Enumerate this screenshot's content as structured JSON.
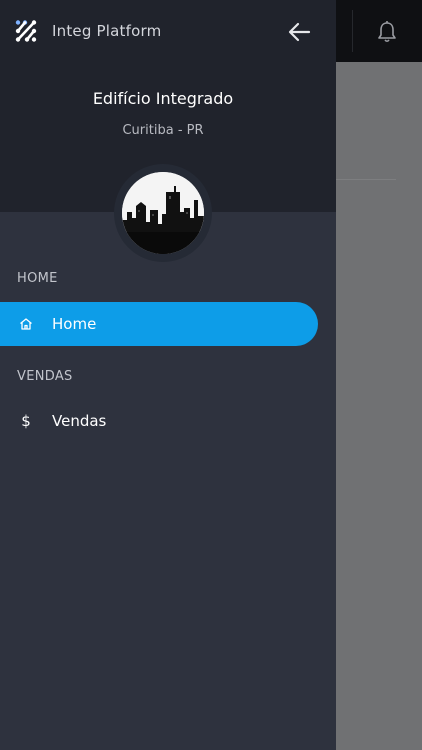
{
  "app": {
    "name": "Integ Platform"
  },
  "profile": {
    "name": "Edifício Integrado",
    "location": "Curitiba - PR"
  },
  "menu": {
    "sections": [
      {
        "title": "HOME",
        "items": [
          {
            "label": "Home",
            "icon": "home-icon",
            "active": true
          }
        ]
      },
      {
        "title": "VENDAS",
        "items": [
          {
            "label": "Vendas",
            "icon": "dollar-icon",
            "active": false
          }
        ]
      }
    ]
  },
  "colors": {
    "accent": "#0d9de8",
    "drawer_bg": "#2e323e",
    "header_bg": "#20232c",
    "overlay": "#6e6f71"
  }
}
